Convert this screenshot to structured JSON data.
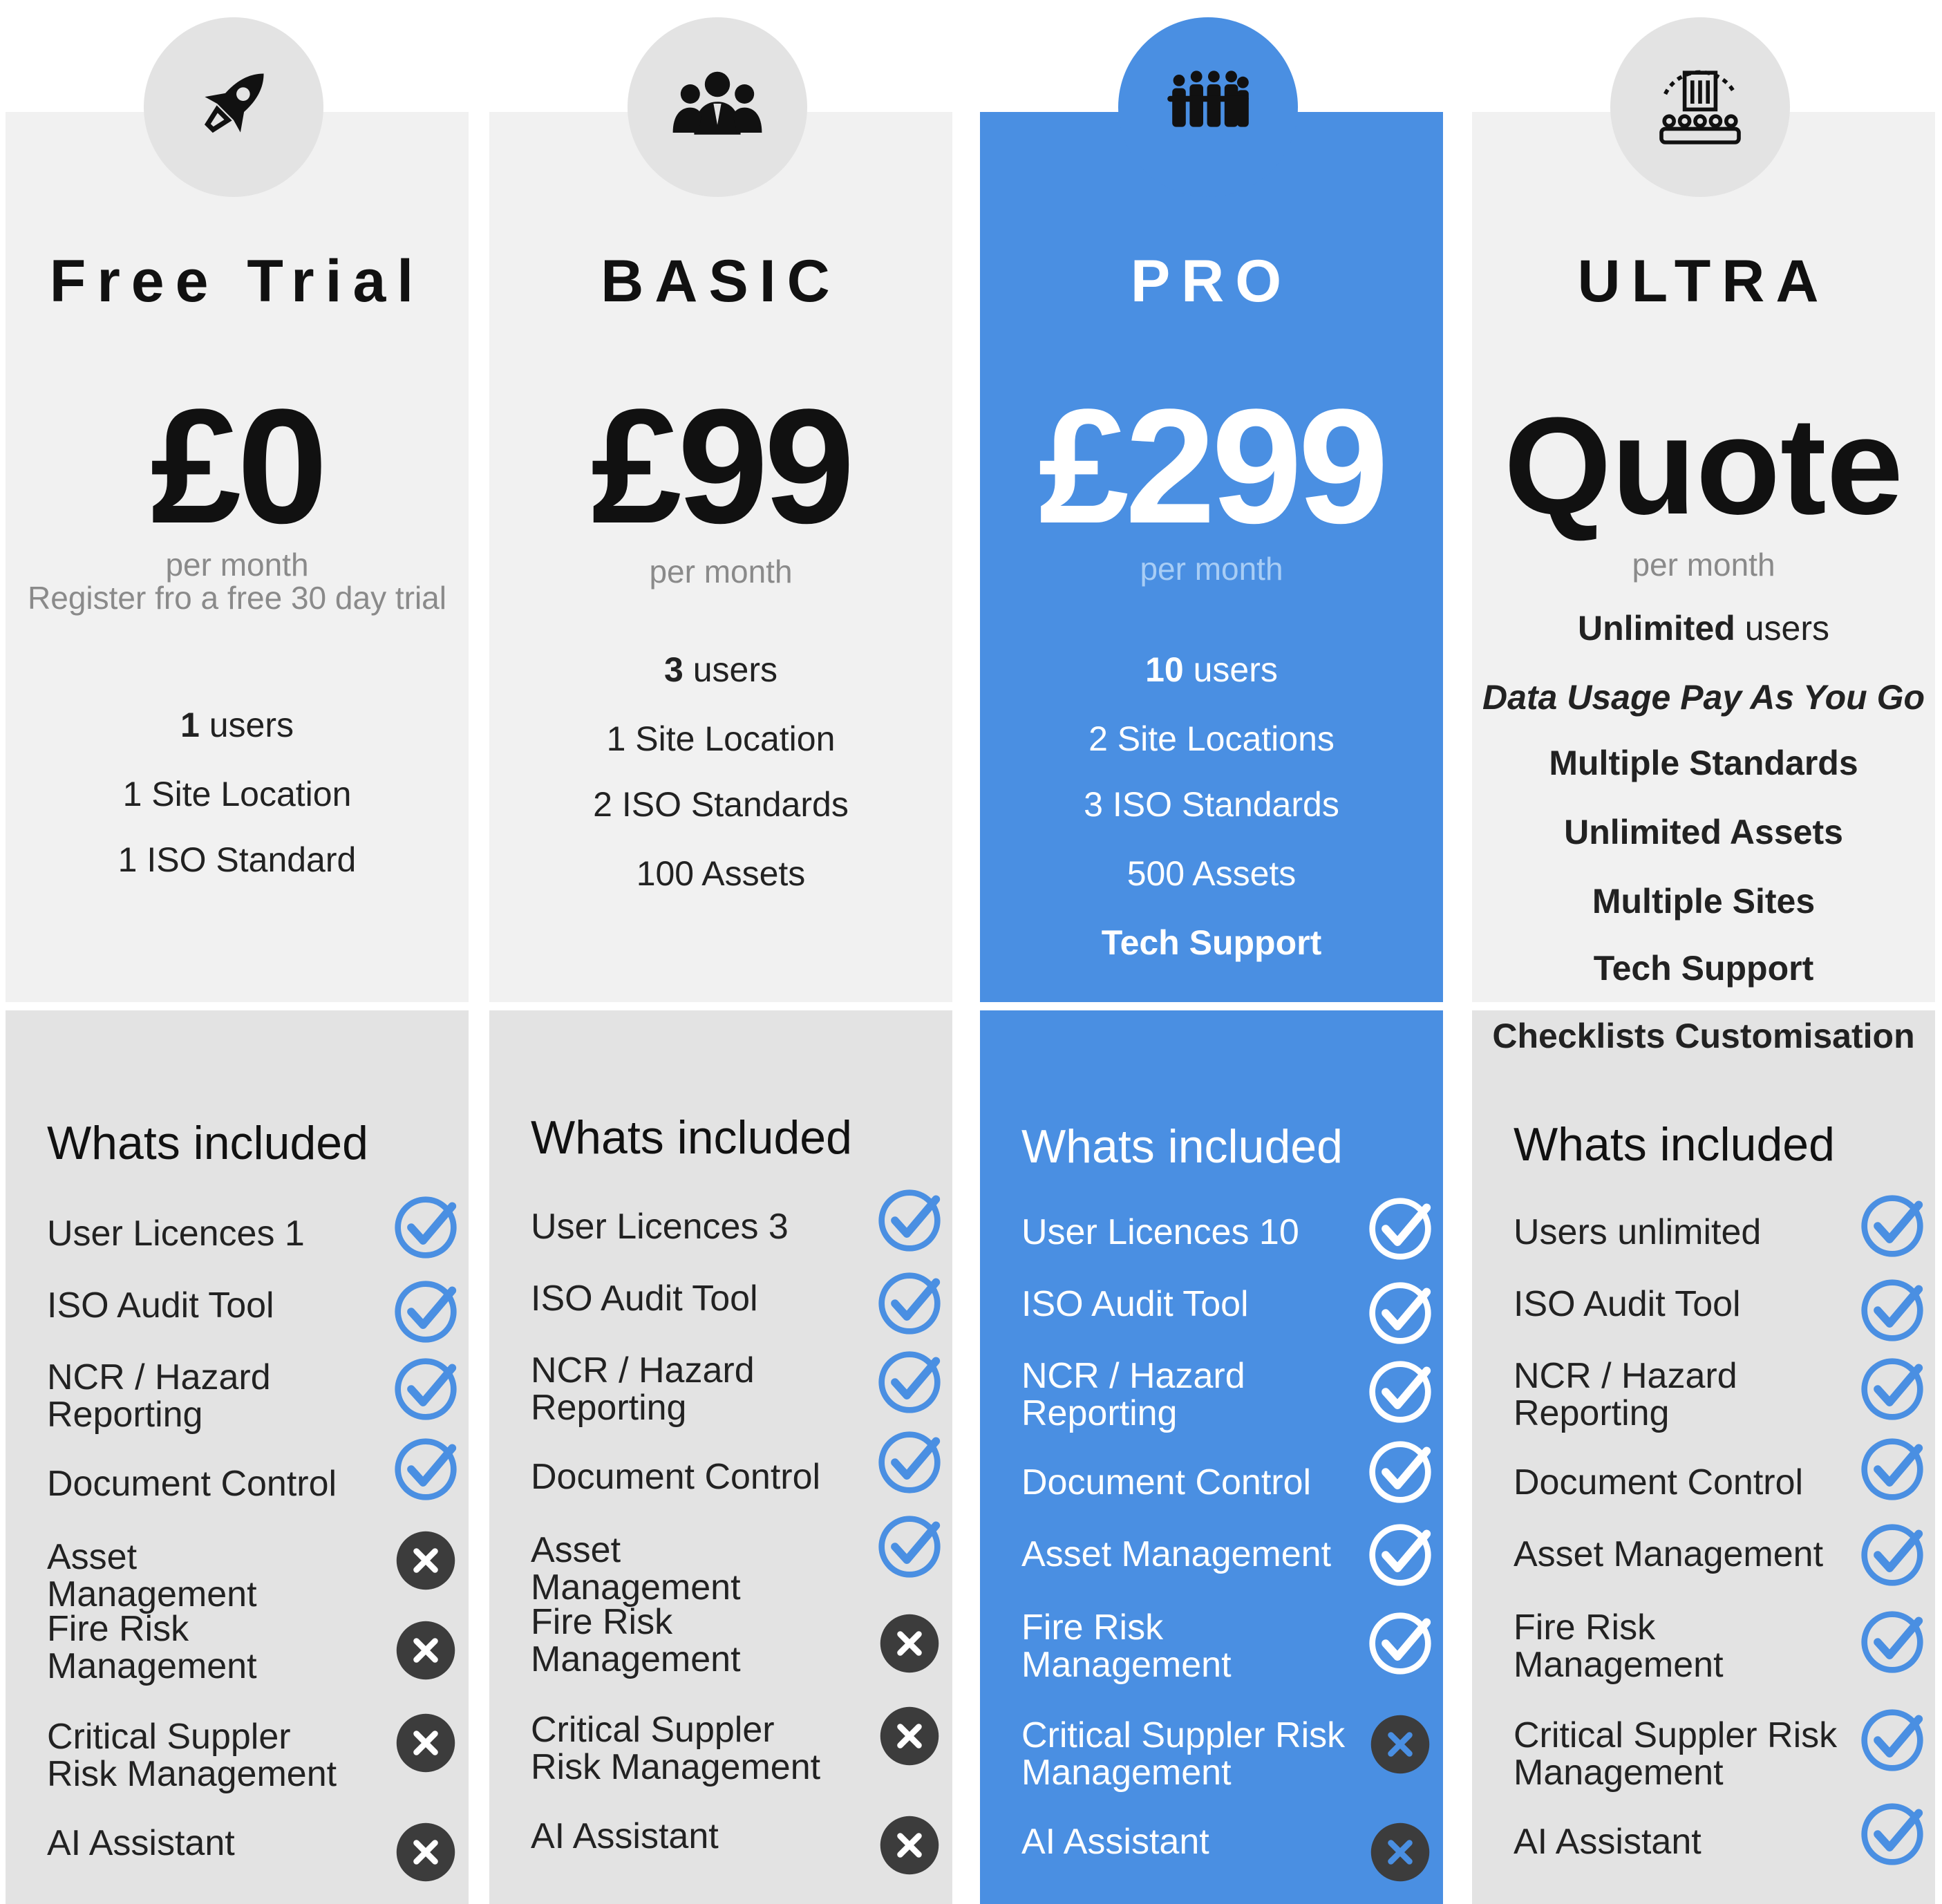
{
  "colors": {
    "accent": "#4a8fe2",
    "panel_light": "#f1f1f1",
    "panel_mid": "#e3e3e3",
    "cross": "#3c3c3c"
  },
  "plans": [
    {
      "name": "Free Trial",
      "icon": "rocket-icon",
      "price": "£0",
      "per": "per month",
      "note": "Register fro a free 30 day trial",
      "features": [
        {
          "bold": "1",
          "text": " users"
        },
        {
          "bold": "",
          "text": "1 Site Location"
        },
        {
          "bold": "",
          "text": "1 ISO Standard"
        }
      ],
      "whats_included": "Whats included",
      "items": [
        {
          "label": "User Licences 1",
          "included": true
        },
        {
          "label": "ISO Audit Tool",
          "included": true
        },
        {
          "label": "NCR / Hazard Reporting",
          "included": true
        },
        {
          "label": "Document Control",
          "included": true
        },
        {
          "label": "Asset Management",
          "included": false
        },
        {
          "label": "Fire Risk Management",
          "included": false
        },
        {
          "label": "Critical Suppler Risk Management",
          "included": false
        },
        {
          "label": "AI Assistant",
          "included": false
        }
      ]
    },
    {
      "name": "BASIC",
      "icon": "business-team-icon",
      "price": "£99",
      "per": "per month",
      "features": [
        {
          "bold": "3",
          "text": " users"
        },
        {
          "bold": "",
          "text": "1 Site Location"
        },
        {
          "bold": "",
          "text": "2 ISO Standards"
        },
        {
          "bold": "",
          "text": "100 Assets"
        }
      ],
      "whats_included": "Whats included",
      "items": [
        {
          "label": "User Licences 3",
          "included": true
        },
        {
          "label": "ISO Audit Tool",
          "included": true
        },
        {
          "label": "NCR / Hazard Reporting",
          "included": true
        },
        {
          "label": "Document Control",
          "included": true
        },
        {
          "label": "Asset Management",
          "included": true
        },
        {
          "label": "Fire Risk Management",
          "included": false
        },
        {
          "label": "Critical Suppler Risk Management",
          "included": false
        },
        {
          "label": "AI Assistant",
          "included": false
        }
      ]
    },
    {
      "name": "PRO",
      "icon": "large-team-icon",
      "price": "£299",
      "per": "per month",
      "features": [
        {
          "bold": "10",
          "text": " users"
        },
        {
          "bold": "",
          "text": "2 Site Locations"
        },
        {
          "bold": "",
          "text": "3 ISO Standards"
        },
        {
          "bold": "",
          "text": "500 Assets"
        },
        {
          "bold": "Tech Support",
          "text": ""
        }
      ],
      "whats_included": "Whats included",
      "items": [
        {
          "label": "User Licences 10",
          "included": true
        },
        {
          "label": "ISO Audit Tool",
          "included": true
        },
        {
          "label": "NCR / Hazard Reporting",
          "included": true
        },
        {
          "label": "Document Control",
          "included": true
        },
        {
          "label": "Asset Management",
          "included": true
        },
        {
          "label": "Fire Risk Management",
          "included": true
        },
        {
          "label": "Critical Suppler Risk Management",
          "included": false
        },
        {
          "label": "AI Assistant",
          "included": false
        }
      ]
    },
    {
      "name": "ULTRA",
      "icon": "enterprise-building-icon",
      "price": "Quote",
      "per": "per month",
      "features": [
        {
          "bold": "Unlimited",
          "text": " users"
        },
        {
          "bold": "Data Usage Pay As You Go",
          "text": "",
          "italic": true
        },
        {
          "bold": "Multiple Standards",
          "text": ""
        },
        {
          "bold": "Unlimited Assets",
          "text": ""
        },
        {
          "bold": "Multiple Sites",
          "text": ""
        },
        {
          "bold": "Tech Support",
          "text": ""
        },
        {
          "bold": "Checklists Customisation",
          "text": ""
        }
      ],
      "whats_included": "Whats included",
      "items": [
        {
          "label": "Users unlimited",
          "included": true
        },
        {
          "label": "ISO Audit Tool",
          "included": true
        },
        {
          "label": "NCR / Hazard Reporting",
          "included": true
        },
        {
          "label": "Document Control",
          "included": true
        },
        {
          "label": "Asset Management",
          "included": true
        },
        {
          "label": "Fire Risk Management",
          "included": true
        },
        {
          "label": "Critical Suppler Risk Management",
          "included": true
        },
        {
          "label": "AI Assistant",
          "included": true
        }
      ]
    }
  ]
}
